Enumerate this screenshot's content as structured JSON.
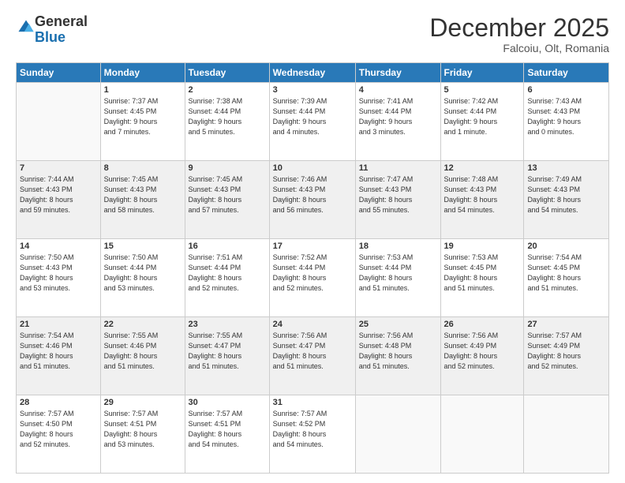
{
  "logo": {
    "general": "General",
    "blue": "Blue"
  },
  "header": {
    "month": "December 2025",
    "location": "Falcoiu, Olt, Romania"
  },
  "weekdays": [
    "Sunday",
    "Monday",
    "Tuesday",
    "Wednesday",
    "Thursday",
    "Friday",
    "Saturday"
  ],
  "weeks": [
    [
      {
        "day": "",
        "info": ""
      },
      {
        "day": "1",
        "info": "Sunrise: 7:37 AM\nSunset: 4:45 PM\nDaylight: 9 hours\nand 7 minutes."
      },
      {
        "day": "2",
        "info": "Sunrise: 7:38 AM\nSunset: 4:44 PM\nDaylight: 9 hours\nand 5 minutes."
      },
      {
        "day": "3",
        "info": "Sunrise: 7:39 AM\nSunset: 4:44 PM\nDaylight: 9 hours\nand 4 minutes."
      },
      {
        "day": "4",
        "info": "Sunrise: 7:41 AM\nSunset: 4:44 PM\nDaylight: 9 hours\nand 3 minutes."
      },
      {
        "day": "5",
        "info": "Sunrise: 7:42 AM\nSunset: 4:44 PM\nDaylight: 9 hours\nand 1 minute."
      },
      {
        "day": "6",
        "info": "Sunrise: 7:43 AM\nSunset: 4:43 PM\nDaylight: 9 hours\nand 0 minutes."
      }
    ],
    [
      {
        "day": "7",
        "info": "Sunrise: 7:44 AM\nSunset: 4:43 PM\nDaylight: 8 hours\nand 59 minutes."
      },
      {
        "day": "8",
        "info": "Sunrise: 7:45 AM\nSunset: 4:43 PM\nDaylight: 8 hours\nand 58 minutes."
      },
      {
        "day": "9",
        "info": "Sunrise: 7:45 AM\nSunset: 4:43 PM\nDaylight: 8 hours\nand 57 minutes."
      },
      {
        "day": "10",
        "info": "Sunrise: 7:46 AM\nSunset: 4:43 PM\nDaylight: 8 hours\nand 56 minutes."
      },
      {
        "day": "11",
        "info": "Sunrise: 7:47 AM\nSunset: 4:43 PM\nDaylight: 8 hours\nand 55 minutes."
      },
      {
        "day": "12",
        "info": "Sunrise: 7:48 AM\nSunset: 4:43 PM\nDaylight: 8 hours\nand 54 minutes."
      },
      {
        "day": "13",
        "info": "Sunrise: 7:49 AM\nSunset: 4:43 PM\nDaylight: 8 hours\nand 54 minutes."
      }
    ],
    [
      {
        "day": "14",
        "info": "Sunrise: 7:50 AM\nSunset: 4:43 PM\nDaylight: 8 hours\nand 53 minutes."
      },
      {
        "day": "15",
        "info": "Sunrise: 7:50 AM\nSunset: 4:44 PM\nDaylight: 8 hours\nand 53 minutes."
      },
      {
        "day": "16",
        "info": "Sunrise: 7:51 AM\nSunset: 4:44 PM\nDaylight: 8 hours\nand 52 minutes."
      },
      {
        "day": "17",
        "info": "Sunrise: 7:52 AM\nSunset: 4:44 PM\nDaylight: 8 hours\nand 52 minutes."
      },
      {
        "day": "18",
        "info": "Sunrise: 7:53 AM\nSunset: 4:44 PM\nDaylight: 8 hours\nand 51 minutes."
      },
      {
        "day": "19",
        "info": "Sunrise: 7:53 AM\nSunset: 4:45 PM\nDaylight: 8 hours\nand 51 minutes."
      },
      {
        "day": "20",
        "info": "Sunrise: 7:54 AM\nSunset: 4:45 PM\nDaylight: 8 hours\nand 51 minutes."
      }
    ],
    [
      {
        "day": "21",
        "info": "Sunrise: 7:54 AM\nSunset: 4:46 PM\nDaylight: 8 hours\nand 51 minutes."
      },
      {
        "day": "22",
        "info": "Sunrise: 7:55 AM\nSunset: 4:46 PM\nDaylight: 8 hours\nand 51 minutes."
      },
      {
        "day": "23",
        "info": "Sunrise: 7:55 AM\nSunset: 4:47 PM\nDaylight: 8 hours\nand 51 minutes."
      },
      {
        "day": "24",
        "info": "Sunrise: 7:56 AM\nSunset: 4:47 PM\nDaylight: 8 hours\nand 51 minutes."
      },
      {
        "day": "25",
        "info": "Sunrise: 7:56 AM\nSunset: 4:48 PM\nDaylight: 8 hours\nand 51 minutes."
      },
      {
        "day": "26",
        "info": "Sunrise: 7:56 AM\nSunset: 4:49 PM\nDaylight: 8 hours\nand 52 minutes."
      },
      {
        "day": "27",
        "info": "Sunrise: 7:57 AM\nSunset: 4:49 PM\nDaylight: 8 hours\nand 52 minutes."
      }
    ],
    [
      {
        "day": "28",
        "info": "Sunrise: 7:57 AM\nSunset: 4:50 PM\nDaylight: 8 hours\nand 52 minutes."
      },
      {
        "day": "29",
        "info": "Sunrise: 7:57 AM\nSunset: 4:51 PM\nDaylight: 8 hours\nand 53 minutes."
      },
      {
        "day": "30",
        "info": "Sunrise: 7:57 AM\nSunset: 4:51 PM\nDaylight: 8 hours\nand 54 minutes."
      },
      {
        "day": "31",
        "info": "Sunrise: 7:57 AM\nSunset: 4:52 PM\nDaylight: 8 hours\nand 54 minutes."
      },
      {
        "day": "",
        "info": ""
      },
      {
        "day": "",
        "info": ""
      },
      {
        "day": "",
        "info": ""
      }
    ]
  ]
}
